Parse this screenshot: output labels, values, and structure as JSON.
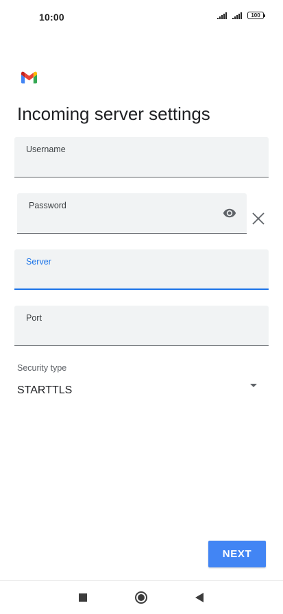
{
  "status_bar": {
    "time": "10:00",
    "battery_level": "100",
    "icons": [
      "signal-icon",
      "signal-icon",
      "battery-icon"
    ]
  },
  "app": {
    "logo": "gmail-logo"
  },
  "page": {
    "title": "Incoming server settings"
  },
  "form": {
    "username": {
      "label": "Username",
      "value": ""
    },
    "password": {
      "label": "Password",
      "value": "",
      "show_password_icon": "eye-icon",
      "clear_icon": "close-icon"
    },
    "server": {
      "label": "Server",
      "value": "",
      "focused": true
    },
    "port": {
      "label": "Port",
      "value": ""
    },
    "security_type": {
      "label": "Security type",
      "selected": "STARTTLS",
      "icon": "dropdown-arrow-icon"
    }
  },
  "actions": {
    "next_label": "NEXT"
  },
  "navigation": {
    "icons": [
      "recents-icon",
      "home-icon",
      "back-icon"
    ]
  },
  "colors": {
    "accent": "#1a73e8",
    "button": "#4285f4",
    "field_background": "#f1f3f4",
    "text": "#202124"
  }
}
